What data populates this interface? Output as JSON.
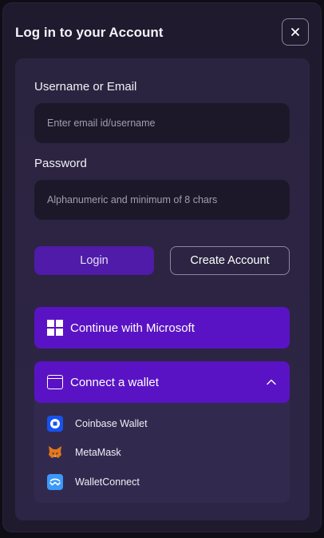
{
  "modal": {
    "title": "Log in to your Account",
    "close_icon": "close-icon"
  },
  "form": {
    "username_label": "Username or Email",
    "username_placeholder": "Enter email id/username",
    "password_label": "Password",
    "password_placeholder": "Alphanumeric and minimum of 8 chars",
    "login_label": "Login",
    "create_label": "Create Account"
  },
  "social": {
    "microsoft_label": "Continue with Microsoft",
    "microsoft_icon": "microsoft-logo-icon"
  },
  "wallet": {
    "header_label": "Connect a wallet",
    "expanded": true,
    "items": [
      {
        "label": "Coinbase Wallet",
        "icon": "coinbase-icon"
      },
      {
        "label": "MetaMask",
        "icon": "metamask-fox-icon"
      },
      {
        "label": "WalletConnect",
        "icon": "walletconnect-icon"
      }
    ]
  },
  "colors": {
    "primary": "#5a13c4",
    "login_button": "#4f1ba8",
    "panel": "#2b2440",
    "modal": "#201a2e"
  }
}
